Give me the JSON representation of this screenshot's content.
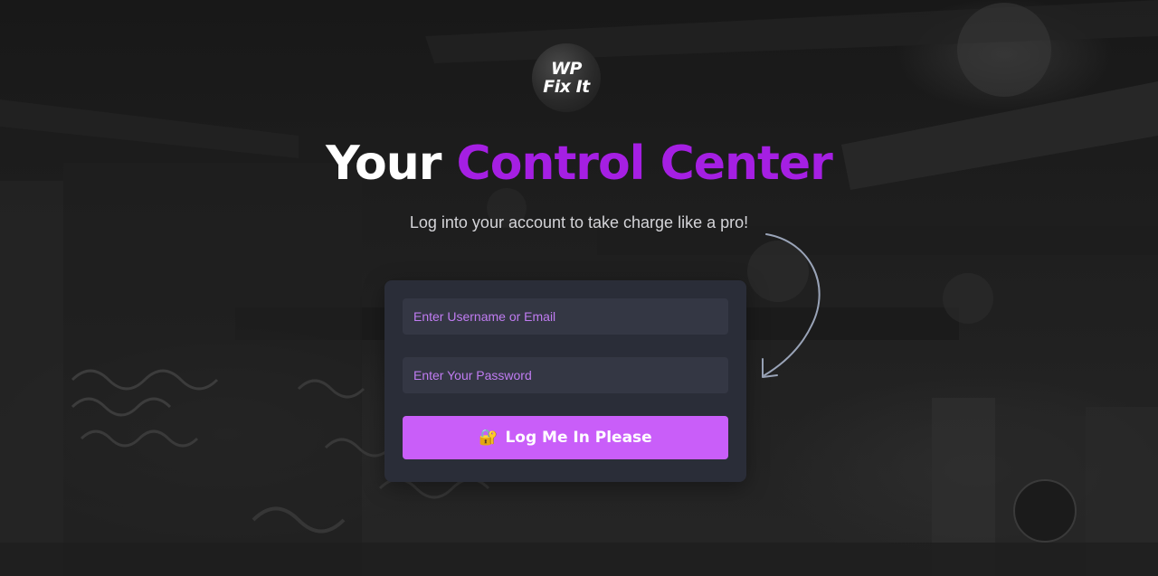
{
  "logo": {
    "line1": "WP",
    "line2": "Fix It"
  },
  "hero": {
    "title_plain": "Your",
    "title_accent": "Control Center",
    "subtitle": "Log into your account to take charge like a pro!"
  },
  "form": {
    "username_placeholder": "Enter Username or Email",
    "username_value": "",
    "password_placeholder": "Enter Your Password",
    "password_value": "",
    "submit_icon": "🔐",
    "submit_label": "Log Me In Please"
  },
  "colors": {
    "accent": "#a51fe3",
    "button": "#c95ef9",
    "card": "#2a2d38",
    "field": "#343744",
    "placeholder": "#c07cf2"
  },
  "icons": {
    "logo": "wp-fix-it-logo-icon",
    "lock": "lock-with-key-icon",
    "arrow": "curved-arrow-icon"
  }
}
